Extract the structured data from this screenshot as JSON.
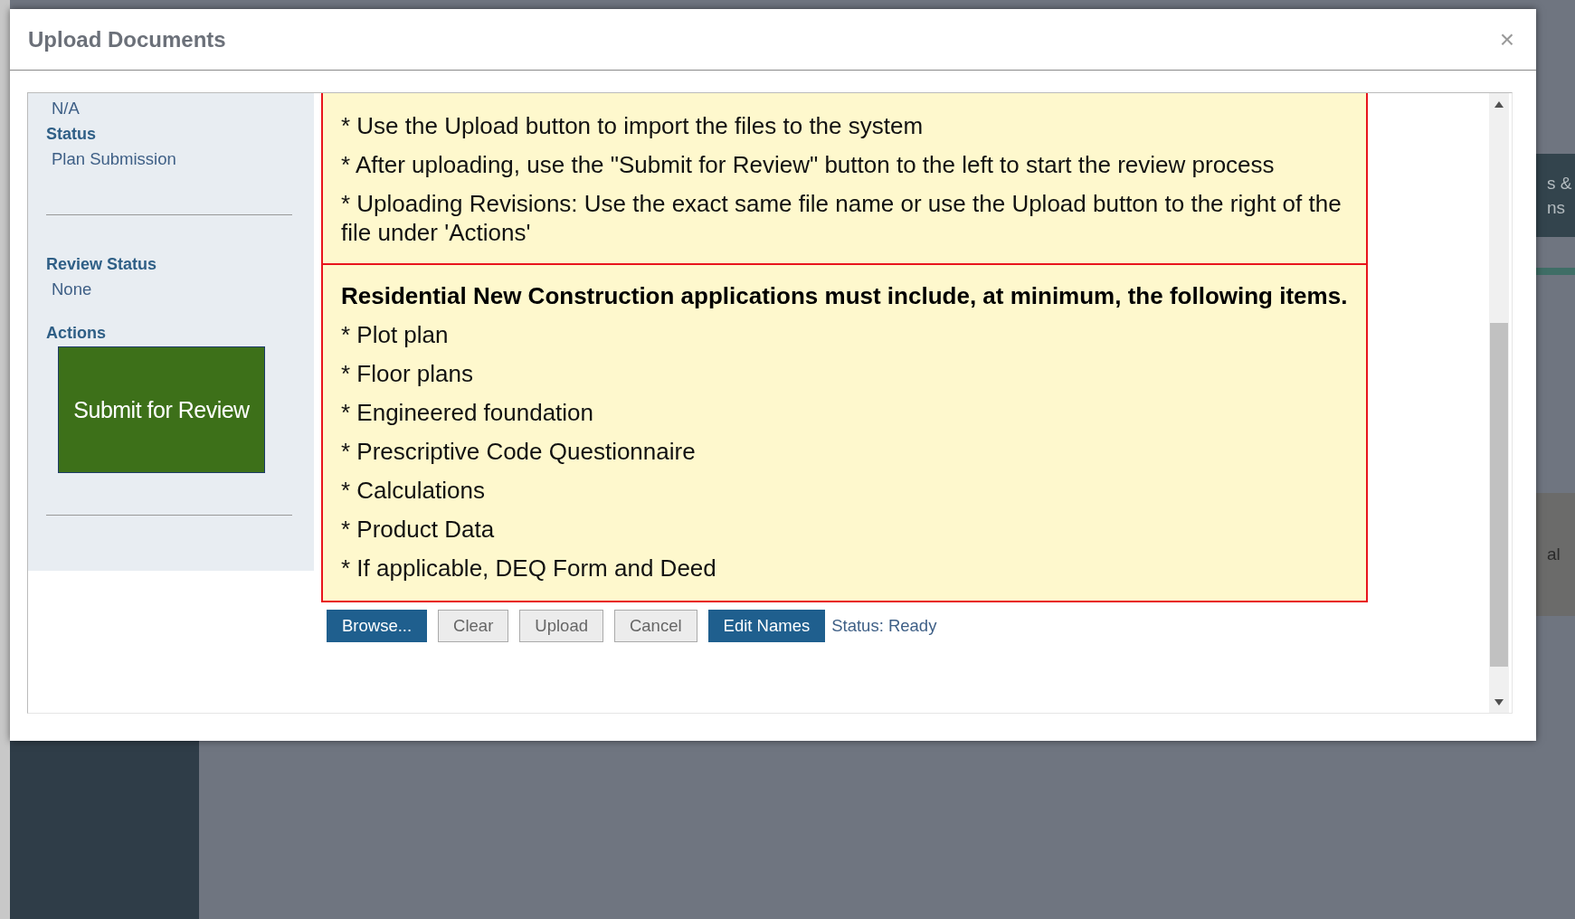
{
  "background": {
    "tile_text": [
      "s &",
      "ns"
    ],
    "panel_text": "al"
  },
  "dialog": {
    "title": "Upload Documents",
    "close": "×"
  },
  "side_panel": {
    "top_value": "N/A",
    "status_label": "Status",
    "status_value": "Plan Submission",
    "review_label": "Review Status",
    "review_value": "None",
    "actions_label": "Actions",
    "submit_button": "Submit for Review"
  },
  "instructions": [
    "* Use the Upload button to import the files to the system",
    "* After uploading, use the \"Submit for Review\" button to the left to start the review process",
    "* Uploading Revisions: Use the exact same file name or use the Upload button to the right of the file under 'Actions'"
  ],
  "requirements": {
    "heading": "Residential New Construction applications must include, at minimum, the following items.",
    "items": [
      "* Plot plan",
      "* Floor plans",
      "* Engineered foundation",
      "* Prescriptive Code Questionnaire",
      "* Calculations",
      "* Product Data",
      "* If applicable, DEQ Form and Deed"
    ]
  },
  "buttons": [
    {
      "label": "Browse...",
      "kind": "primary"
    },
    {
      "label": "Clear",
      "kind": "secondary"
    },
    {
      "label": "Upload",
      "kind": "secondary"
    },
    {
      "label": "Cancel",
      "kind": "secondary"
    },
    {
      "label": "Edit Names",
      "kind": "primary"
    }
  ],
  "status_text": "Status: Ready"
}
